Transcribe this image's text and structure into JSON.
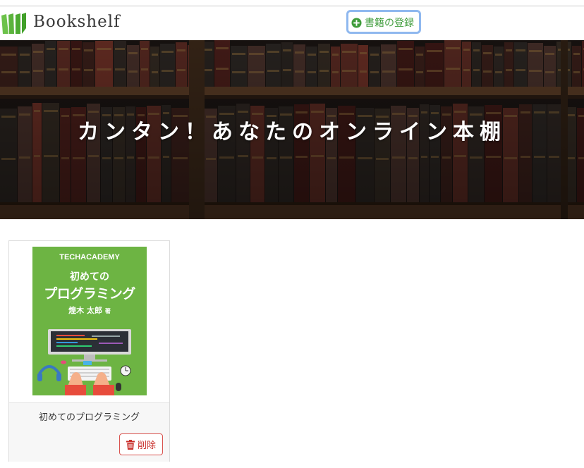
{
  "colors": {
    "accent_green": "#3f9c3b",
    "danger_red": "#c9302c",
    "focus_blue": "#8fb8ef"
  },
  "navbar": {
    "brand": "Bookshelf",
    "register_button": {
      "label": "書籍の登録",
      "icon": "plus-circle-icon"
    }
  },
  "hero": {
    "title": "カンタン！あなたのオンライン本棚"
  },
  "books": [
    {
      "title": "初めてのプログラミング",
      "delete_label": "削除",
      "delete_icon": "trash-icon",
      "cover": {
        "publisher": "TECHACADEMY",
        "title_line1": "初めての",
        "title_line2": "プログラミング",
        "author": "煌木 太郎",
        "author_suffix": "著"
      }
    }
  ]
}
